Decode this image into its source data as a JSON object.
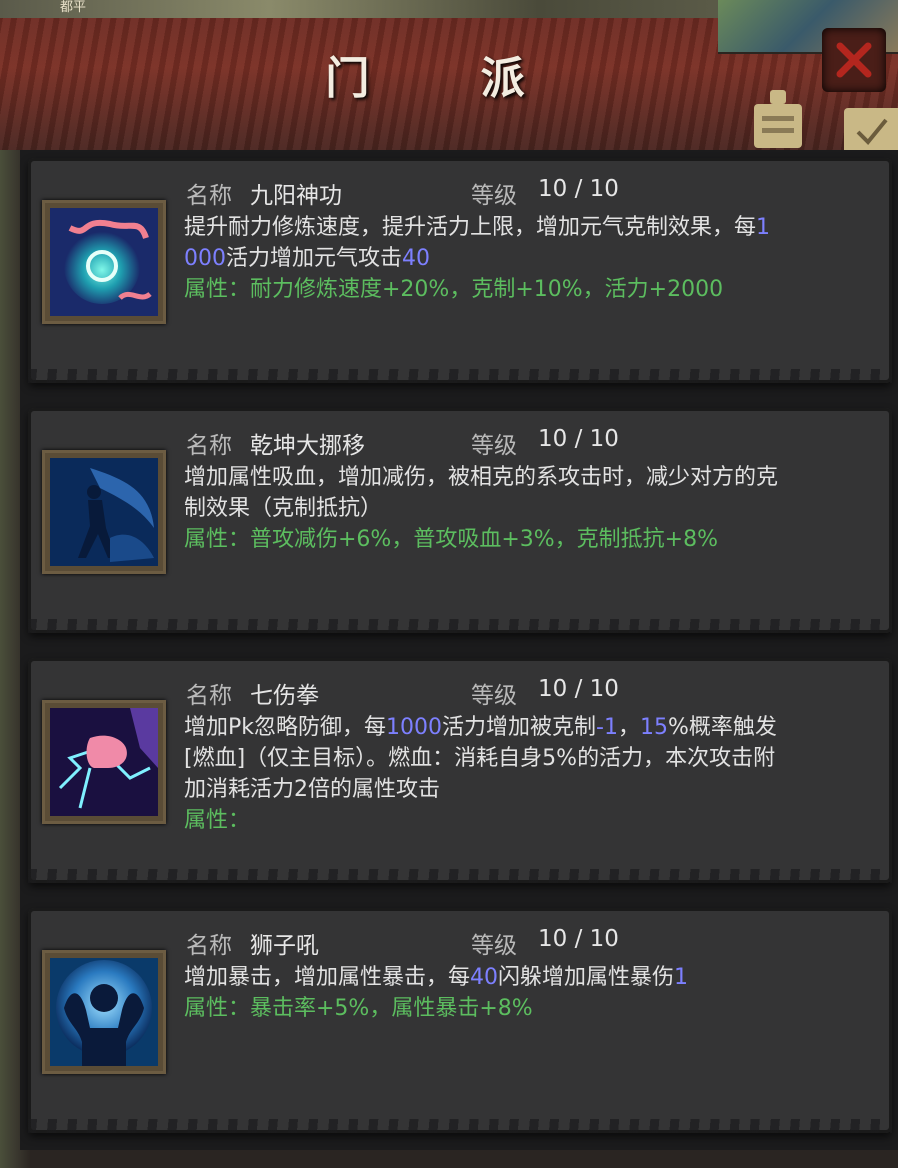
{
  "window": {
    "title": "门 派",
    "corner_text": "都平"
  },
  "colors": {
    "highlight": "#7d80ff",
    "attribute": "#5cbd5f",
    "text": "#e2e2e2",
    "card_bg": "#343435"
  },
  "labels": {
    "name": "名称",
    "level": "等级"
  },
  "skills": [
    {
      "name": "九阳神功",
      "level": "10 / 10",
      "icon": "glowing-claw-orb-icon",
      "desc": [
        {
          "t": "提升耐力修炼速度，提升活力上限，增加元气克制效果，每"
        },
        {
          "t": "1000",
          "hl": true
        },
        {
          "t": "活力增加元气攻击"
        },
        {
          "t": "40",
          "hl": true
        }
      ],
      "attr": "属性：耐力修炼速度+20%，克制+10%，活力+2000"
    },
    {
      "name": "乾坤大挪移",
      "level": "10 / 10",
      "icon": "martial-artist-silhouette-icon",
      "desc": [
        {
          "t": "增加属性吸血，增加减伤，被相克的系攻击时，减少对方的克制效果（克制抵抗）"
        }
      ],
      "attr": "属性：普攻减伤+6%，普攻吸血+3%，克制抵抗+8%"
    },
    {
      "name": "七伤拳",
      "level": "10 / 10",
      "icon": "lightning-fist-icon",
      "desc": [
        {
          "t": "增加Pk忽略防御，每"
        },
        {
          "t": "1000",
          "hl": true
        },
        {
          "t": "活力增加被克制"
        },
        {
          "t": "-1",
          "hl": true
        },
        {
          "t": "，"
        },
        {
          "t": "15",
          "hl": true
        },
        {
          "t": "%概率触发[燃血]（仅主目标）。燃血：消耗自身5%的活力，本次攻击附加消耗活力2倍的属性攻击"
        }
      ],
      "attr": "属性："
    },
    {
      "name": "狮子吼",
      "level": "10 / 10",
      "icon": "roaring-figure-icon",
      "desc": [
        {
          "t": "增加暴击，增加属性暴击，每"
        },
        {
          "t": "40",
          "hl": true
        },
        {
          "t": "闪躲增加属性暴伤"
        },
        {
          "t": "1",
          "hl": true
        }
      ],
      "attr": "属性：暴击率+5%，属性暴击+8%"
    }
  ]
}
